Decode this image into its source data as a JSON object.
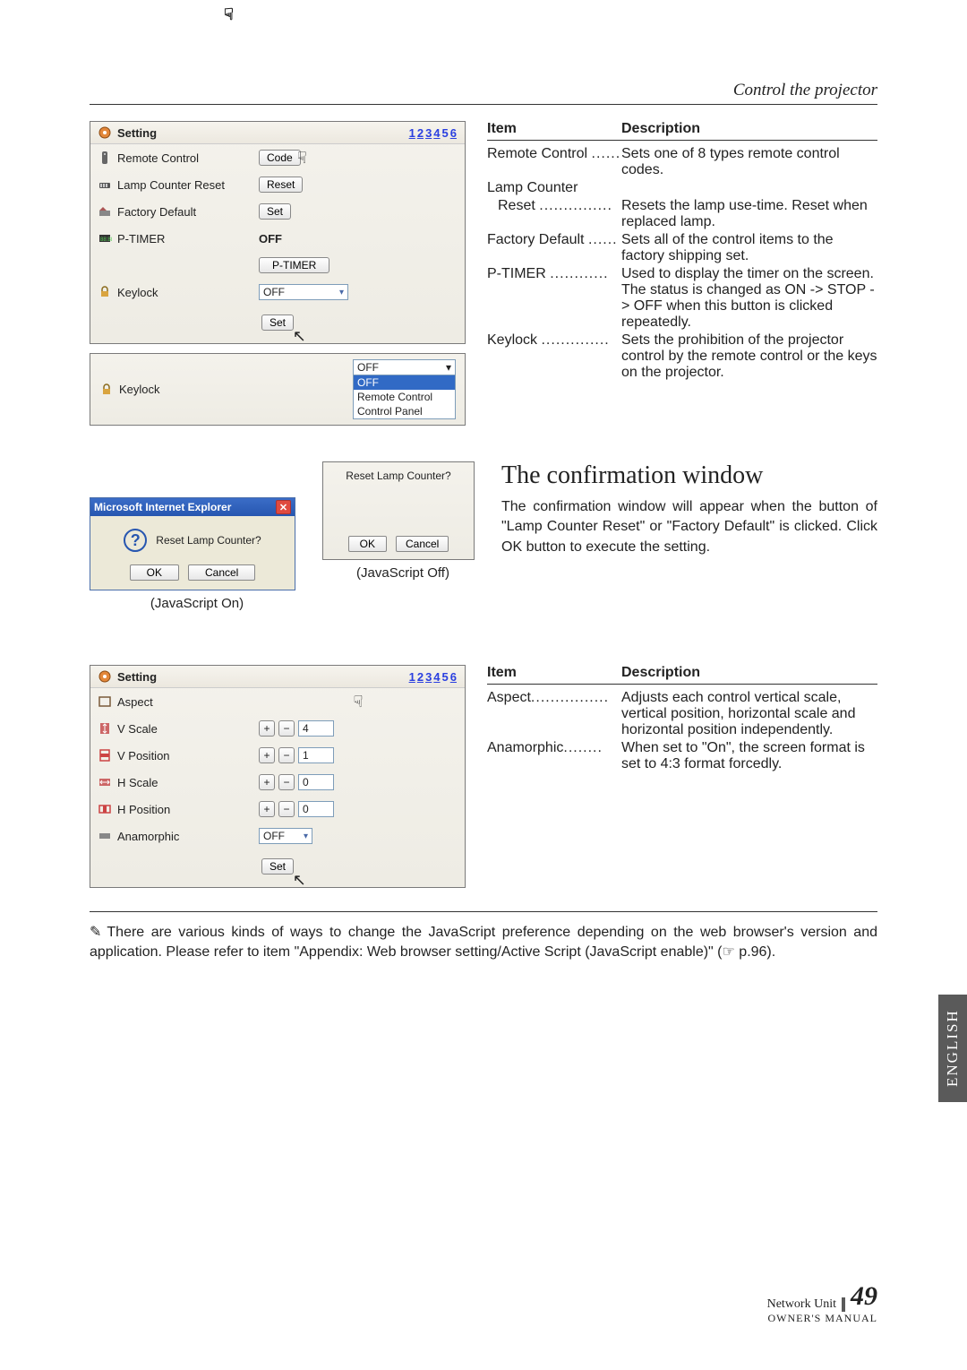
{
  "header": {
    "title": "Control the projector"
  },
  "pageNav": {
    "links": [
      "1",
      "2",
      "3",
      "4",
      "5",
      "6"
    ],
    "active": "5"
  },
  "panel1": {
    "title": "Setting",
    "rows": {
      "remote": {
        "label": "Remote Control",
        "btn": "Code"
      },
      "lamp": {
        "label": "Lamp Counter Reset",
        "btn": "Reset"
      },
      "factory": {
        "label": "Factory Default",
        "btn": "Set"
      },
      "ptimer": {
        "label": "P-TIMER",
        "status": "OFF",
        "btn": "P-TIMER"
      },
      "keylock": {
        "label": "Keylock",
        "value": "OFF"
      }
    },
    "setBtn": "Set"
  },
  "miniKeylock": {
    "label": "Keylock",
    "selected": "OFF",
    "options": [
      "OFF",
      "Remote Control",
      "Control Panel"
    ],
    "highlighted": "OFF"
  },
  "descTable1": {
    "head": {
      "c1": "Item",
      "c2": "Description"
    },
    "rows": [
      {
        "item": "Remote Control",
        "desc": "Sets one of 8 types remote control codes."
      },
      {
        "item": "Lamp Counter",
        "desc": ""
      },
      {
        "item": "Reset",
        "desc": "Resets the lamp use-time. Reset when replaced lamp."
      },
      {
        "item": "Factory Default",
        "desc": "Sets all of the control items to the factory shipping set."
      },
      {
        "item": "P-TIMER",
        "desc": "Used to display the timer on the screen. The status is changed as ON -> STOP -> OFF when this button is clicked repeatedly."
      },
      {
        "item": "Keylock",
        "desc": "Sets the prohibition of the projector control by the remote control or the keys on the projector."
      }
    ]
  },
  "confirmation": {
    "headline": "The confirmation window",
    "body": "The confirmation window will appear when the button of \"Lamp Counter Reset\" or \"Factory Default\" is clicked. Click OK button to execute the setting.",
    "ieDialog": {
      "title": "Microsoft Internet Explorer",
      "question": "Reset Lamp Counter?",
      "ok": "OK",
      "cancel": "Cancel",
      "caption": "(JavaScript On)"
    },
    "plainDialog": {
      "question": "Reset Lamp Counter?",
      "ok": "OK",
      "cancel": "Cancel",
      "caption": "(JavaScript Off)"
    }
  },
  "panel2": {
    "title": "Setting",
    "rows": {
      "aspect": {
        "label": "Aspect"
      },
      "vscale": {
        "label": "V Scale",
        "value": "4"
      },
      "vpos": {
        "label": "V Position",
        "value": "1"
      },
      "hscale": {
        "label": "H Scale",
        "value": "0"
      },
      "hpos": {
        "label": "H Position",
        "value": "0"
      },
      "anam": {
        "label": "Anamorphic",
        "value": "OFF"
      }
    },
    "setBtn": "Set"
  },
  "descTable2": {
    "head": {
      "c1": "Item",
      "c2": "Description"
    },
    "rows": [
      {
        "item": "Aspect",
        "desc": "Adjusts each control vertical scale, vertical position, horizontal scale and horizontal position independently."
      },
      {
        "item": "Anamorphic",
        "desc": "When set to \"On\", the screen format is set to 4:3 format forcedly."
      }
    ]
  },
  "sideTab": "ENGLISH",
  "footnote": "There are various kinds of ways to change the JavaScript preference depending on the web browser's version and application. Please refer to item \"Appendix: Web browser setting/Active Script (JavaScript enable)\" (☞ p.96).",
  "footer": {
    "unit": "Network Unit",
    "pageNum": "49",
    "manual": "OWNER'S MANUAL"
  }
}
